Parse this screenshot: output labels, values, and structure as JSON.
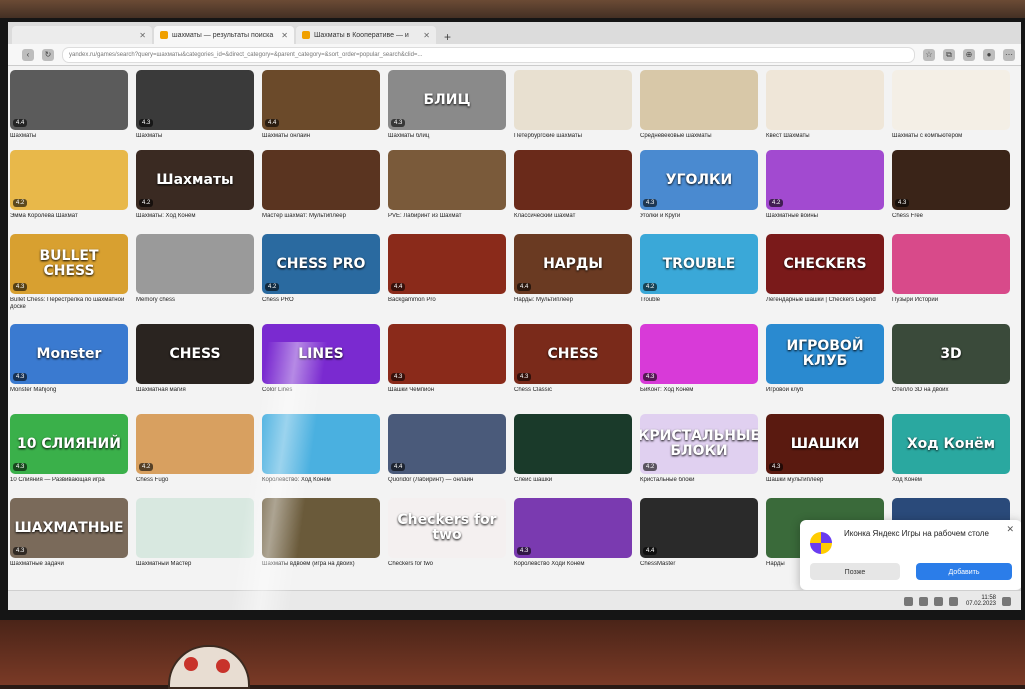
{
  "browser": {
    "tabs": [
      {
        "label": "шахматы — результаты поиска"
      },
      {
        "label": "Шахматы в Кооперативе — и"
      }
    ],
    "new_tab": "+",
    "url": "yandex.ru/games/search?query=шахматы&categories_id=&direct_category=&parent_category=&sort_order=popular_search&clid=..."
  },
  "games": [
    {
      "title": "Шахматы",
      "rating": "4.4",
      "color": "#5b5b5b",
      "art": ""
    },
    {
      "title": "Шахматы",
      "rating": "4.3",
      "color": "#3a3a3a",
      "art": ""
    },
    {
      "title": "Шахматы онлайн",
      "rating": "4.4",
      "color": "#6b4a2a",
      "art": ""
    },
    {
      "title": "Шахматы блиц",
      "rating": "4.3",
      "color": "#8a8a8a",
      "art": "БЛИЦ"
    },
    {
      "title": "Петербургские шахматы",
      "rating": "",
      "color": "#e8e0d0",
      "art": ""
    },
    {
      "title": "Средневековые шахматы",
      "rating": "",
      "color": "#d8c8a8",
      "art": ""
    },
    {
      "title": "Квест Шахматы",
      "rating": "",
      "color": "#efe6d8",
      "art": ""
    },
    {
      "title": "Шахматы с компьютером",
      "rating": "",
      "color": "#f4efe6",
      "art": ""
    },
    {
      "title": "Эмма Королева Шахмат",
      "rating": "4.2",
      "color": "#e8b84a",
      "art": ""
    },
    {
      "title": "Шахматы: Ход Конём",
      "rating": "4.2",
      "color": "#3a2a22",
      "art": "Шахматы"
    },
    {
      "title": "Мастер шахмат: Мультиплеер",
      "rating": "",
      "color": "#5a3420",
      "art": ""
    },
    {
      "title": "PVE: Лабиринт из Шахмат",
      "rating": "",
      "color": "#7a5a3a",
      "art": ""
    },
    {
      "title": "Классический шахмат",
      "rating": "",
      "color": "#6a2a1a",
      "art": ""
    },
    {
      "title": "Уголки и Круги",
      "rating": "4.3",
      "color": "#4a8ad0",
      "art": "УГОЛКИ"
    },
    {
      "title": "Шахматные войны",
      "rating": "4.2",
      "color": "#a24ad0",
      "art": ""
    },
    {
      "title": "Chess Free",
      "rating": "4.3",
      "color": "#3a2418",
      "art": ""
    },
    {
      "title": "Bullet Chess: Перестрелка по шахматной доске",
      "rating": "4.3",
      "color": "#d8a030",
      "art": "BULLET CHESS"
    },
    {
      "title": "Memory chess",
      "rating": "",
      "color": "#9a9a9a",
      "art": ""
    },
    {
      "title": "Chess PRO",
      "rating": "4.2",
      "color": "#2a6aa0",
      "art": "CHESS PRO"
    },
    {
      "title": "Backgammon Pro",
      "rating": "4.4",
      "color": "#8a2a1a",
      "art": ""
    },
    {
      "title": "Нарды: Мультиплеер",
      "rating": "4.4",
      "color": "#6a3a22",
      "art": "НАРДЫ"
    },
    {
      "title": "Trouble",
      "rating": "4.2",
      "color": "#3aa8d8",
      "art": "TROUBLE"
    },
    {
      "title": "Легендарные шашки | Checkers Legend",
      "rating": "",
      "color": "#7a1a1a",
      "art": "CHECKERS"
    },
    {
      "title": "Пузыри Истории",
      "rating": "",
      "color": "#d84a8a",
      "art": ""
    },
    {
      "title": "Monster Mahjong",
      "rating": "4.3",
      "color": "#3a7ad0",
      "art": "Monster"
    },
    {
      "title": "Шахматная магия",
      "rating": "",
      "color": "#2a2420",
      "art": "CHESS"
    },
    {
      "title": "Color Lines",
      "rating": "",
      "color": "#7a2ad0",
      "art": "LINES"
    },
    {
      "title": "Шашки Чемпион",
      "rating": "4.3",
      "color": "#8a2a1a",
      "art": ""
    },
    {
      "title": "Chess Classic",
      "rating": "4.3",
      "color": "#7a2a1a",
      "art": "CHESS"
    },
    {
      "title": "БиКонт: Ход Конём",
      "rating": "4.3",
      "color": "#d83ad8",
      "art": ""
    },
    {
      "title": "Игровой клуб",
      "rating": "",
      "color": "#2a8ad0",
      "art": "ИГРОВОЙ КЛУБ"
    },
    {
      "title": "Отелло 3D на двоих",
      "rating": "",
      "color": "#3a4a3a",
      "art": "3D"
    },
    {
      "title": "10 Слияния — Развивающая игра",
      "rating": "4.3",
      "color": "#3ab04a",
      "art": "10 СЛИЯНИЙ"
    },
    {
      "title": "Chess Fugo",
      "rating": "4.2",
      "color": "#d8a060",
      "art": ""
    },
    {
      "title": "Королевство: Ход Конём",
      "rating": "",
      "color": "#4ab0e0",
      "art": ""
    },
    {
      "title": "Quoridor (Лабиринт) — онлайн",
      "rating": "4.4",
      "color": "#4a5a7a",
      "art": ""
    },
    {
      "title": "Слейс шашки",
      "rating": "",
      "color": "#1a3a2a",
      "art": ""
    },
    {
      "title": "Кристальные блоки",
      "rating": "4.2",
      "color": "#e0d0f0",
      "art": "КРИСТАЛЬНЫЕ БЛОКИ"
    },
    {
      "title": "Шашки мультиплеер",
      "rating": "4.3",
      "color": "#5a1a10",
      "art": "ШАШКИ"
    },
    {
      "title": "Ход Конём",
      "rating": "",
      "color": "#2aa8a0",
      "art": "Ход Конём"
    },
    {
      "title": "Шахматные задачи",
      "rating": "4.3",
      "color": "#7a6a5a",
      "art": "ШАХМАТНЫЕ"
    },
    {
      "title": "Шахматный Мастер",
      "rating": "",
      "color": "#d8e8e0",
      "art": ""
    },
    {
      "title": "Шахматы вдвоём (игра на двоих)",
      "rating": "",
      "color": "#6a5a3a",
      "art": ""
    },
    {
      "title": "Checkers for two",
      "rating": "",
      "color": "#f4f0f0",
      "art": "Checkers for two"
    },
    {
      "title": "Королевство Ходи Конём",
      "rating": "4.3",
      "color": "#7a3ab0",
      "art": ""
    },
    {
      "title": "ChessMaster",
      "rating": "4.4",
      "color": "#2a2a2a",
      "art": ""
    },
    {
      "title": "Нарды",
      "rating": "",
      "color": "#3a6a3a",
      "art": ""
    },
    {
      "title": "",
      "rating": "",
      "color": "#2a4a7a",
      "art": ""
    }
  ],
  "notification": {
    "message": "Иконка Яндекс Игры на рабочем столе",
    "later_label": "Позже",
    "add_label": "Добавить",
    "close": "✕"
  },
  "taskbar": {
    "time": "11:58",
    "date": "07.02.2023"
  }
}
